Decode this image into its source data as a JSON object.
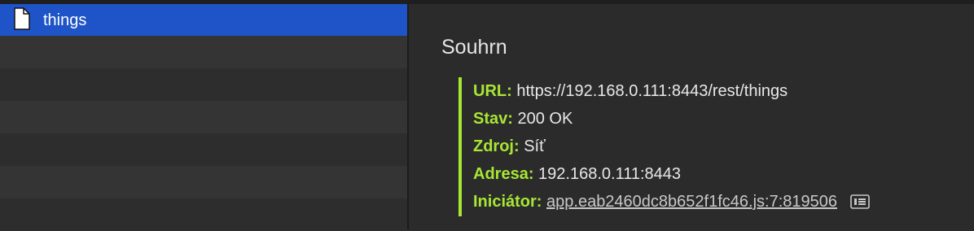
{
  "request_list": {
    "items": [
      {
        "label": "things",
        "icon": "document-icon",
        "selected": true
      }
    ]
  },
  "summary": {
    "title": "Souhrn",
    "url_key": "URL:",
    "url_value": "https://192.168.0.111:8443/rest/things",
    "status_key": "Stav:",
    "status_value": "200 OK",
    "source_key": "Zdroj:",
    "source_value": "Síť",
    "address_key": "Adresa:",
    "address_value": "192.168.0.111:8443",
    "initiator_key": "Iniciátor:",
    "initiator_value": "app.eab2460dc8b652f1fc46.js:7:819506"
  },
  "colors": {
    "selection": "#1e54c7",
    "key_accent": "#a8e634"
  }
}
